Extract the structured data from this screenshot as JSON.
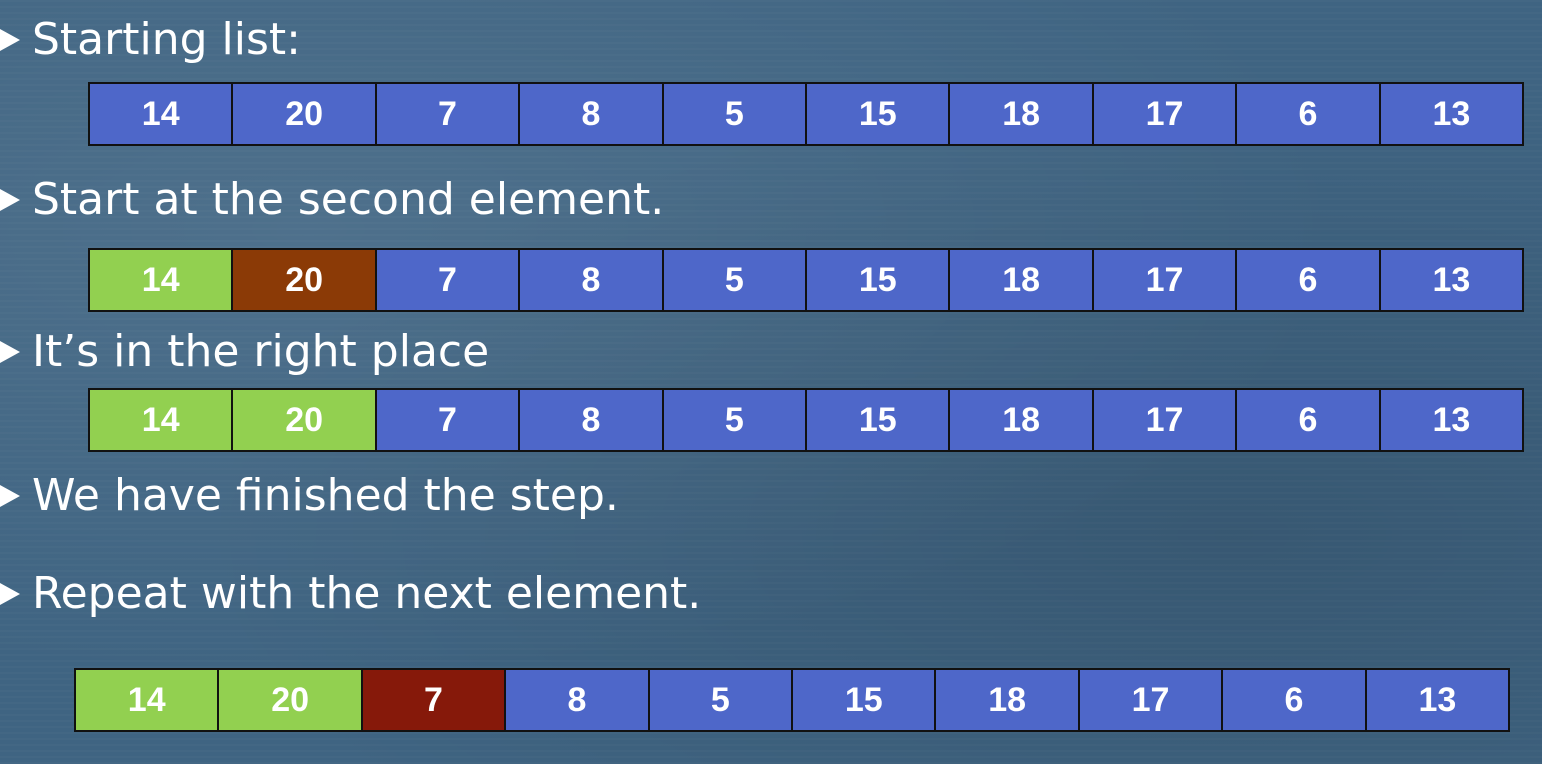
{
  "colors": {
    "default": "#4e67c9",
    "sorted": "#92d050",
    "current": "#8b3a06",
    "current_alt": "#86190a"
  },
  "bullets": [
    "Starting list:",
    "Start at the second element.",
    "It’s in the right place",
    "We have finished the step.",
    "Repeat with the next element."
  ],
  "rows": [
    {
      "cells": [
        {
          "value": "14",
          "state": "default"
        },
        {
          "value": "20",
          "state": "default"
        },
        {
          "value": "7",
          "state": "default"
        },
        {
          "value": "8",
          "state": "default"
        },
        {
          "value": "5",
          "state": "default"
        },
        {
          "value": "15",
          "state": "default"
        },
        {
          "value": "18",
          "state": "default"
        },
        {
          "value": "17",
          "state": "default"
        },
        {
          "value": "6",
          "state": "default"
        },
        {
          "value": "13",
          "state": "default"
        }
      ]
    },
    {
      "cells": [
        {
          "value": "14",
          "state": "sorted"
        },
        {
          "value": "20",
          "state": "current"
        },
        {
          "value": "7",
          "state": "default"
        },
        {
          "value": "8",
          "state": "default"
        },
        {
          "value": "5",
          "state": "default"
        },
        {
          "value": "15",
          "state": "default"
        },
        {
          "value": "18",
          "state": "default"
        },
        {
          "value": "17",
          "state": "default"
        },
        {
          "value": "6",
          "state": "default"
        },
        {
          "value": "13",
          "state": "default"
        }
      ]
    },
    {
      "cells": [
        {
          "value": "14",
          "state": "sorted"
        },
        {
          "value": "20",
          "state": "sorted"
        },
        {
          "value": "7",
          "state": "default"
        },
        {
          "value": "8",
          "state": "default"
        },
        {
          "value": "5",
          "state": "default"
        },
        {
          "value": "15",
          "state": "default"
        },
        {
          "value": "18",
          "state": "default"
        },
        {
          "value": "17",
          "state": "default"
        },
        {
          "value": "6",
          "state": "default"
        },
        {
          "value": "13",
          "state": "default"
        }
      ]
    },
    {
      "cells": [
        {
          "value": "14",
          "state": "sorted"
        },
        {
          "value": "20",
          "state": "sorted"
        },
        {
          "value": "7",
          "state": "current_alt"
        },
        {
          "value": "8",
          "state": "default"
        },
        {
          "value": "5",
          "state": "default"
        },
        {
          "value": "15",
          "state": "default"
        },
        {
          "value": "18",
          "state": "default"
        },
        {
          "value": "17",
          "state": "default"
        },
        {
          "value": "6",
          "state": "default"
        },
        {
          "value": "13",
          "state": "default"
        }
      ]
    }
  ]
}
